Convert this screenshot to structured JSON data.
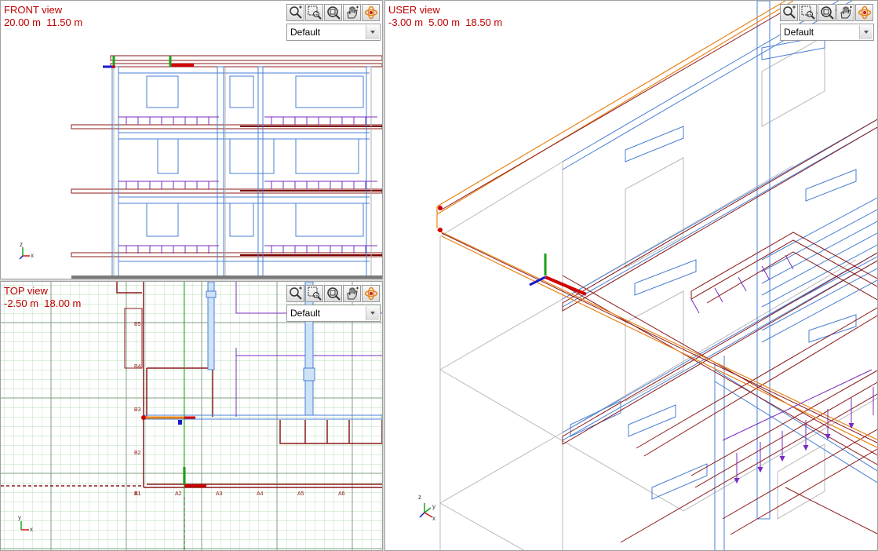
{
  "viewports": {
    "front": {
      "title": "FRONT view",
      "coords": "20.00 m  11.50 m",
      "style": "Default"
    },
    "top": {
      "title": "TOP view",
      "coords": "-2.50 m  18.00 m",
      "style": "Default"
    },
    "user": {
      "title": "USER view",
      "coords": "-3.00 m  5.00 m  18.50 m",
      "style": "Default"
    }
  },
  "toolbar_icons": [
    "zoom-in-icon",
    "zoom-window-icon",
    "zoom-extents-icon",
    "pan-hand-icon",
    "orbit-icon"
  ],
  "axis_labels": {
    "x": "x",
    "y": "y",
    "z": "z"
  },
  "colors": {
    "label_red": "#c00000",
    "beam_darkred": "#8b1a1a",
    "structure_blue": "#4a7fd4",
    "rebar_purple": "#7b2cbf",
    "grid_green": "#9fd49f",
    "highlight_orange": "#e8851a"
  }
}
